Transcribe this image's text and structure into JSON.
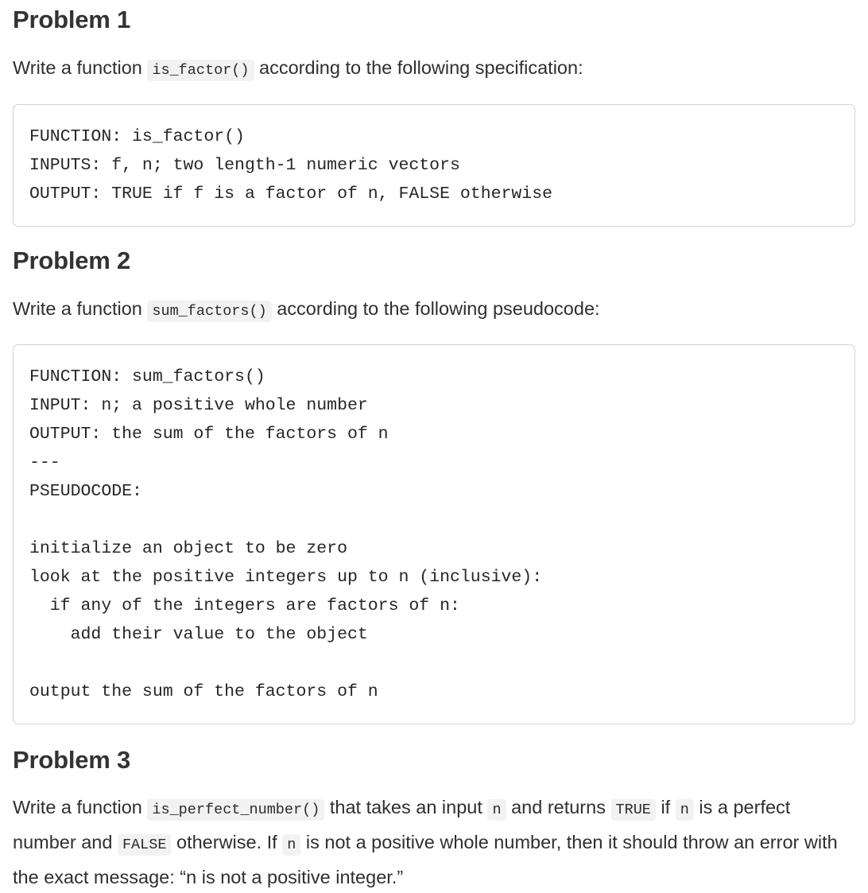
{
  "document": {
    "colors": {
      "text": "#2f2f2f",
      "heading": "#333333",
      "code_text": "#262626",
      "inline_code_bg": "#f2f2f2",
      "box_border": "#d2d2d2",
      "background": "#ffffff"
    },
    "problems": [
      {
        "heading": "Problem 1",
        "prompt": {
          "before": "Write a function",
          "code": "is_factor()",
          "after": "according to the following specification:"
        },
        "code_block": "FUNCTION: is_factor()\nINPUTS: f, n; two length-1 numeric vectors\nOUTPUT: TRUE if f is a factor of n, FALSE otherwise"
      },
      {
        "heading": "Problem 2",
        "prompt": {
          "before": "Write a function",
          "code": "sum_factors()",
          "after": "according to the following pseudocode:"
        },
        "code_block": "FUNCTION: sum_factors()\nINPUT: n; a positive whole number\nOUTPUT: the sum of the factors of n\n---\nPSEUDOCODE:\n\ninitialize an object to be zero\nlook at the positive integers up to n (inclusive):\n  if any of the integers are factors of n:\n    add their value to the object\n\noutput the sum of the factors of n"
      },
      {
        "heading": "Problem 3",
        "body": {
          "s1": "Write a function",
          "c1": "is_perfect_number()",
          "s2": "that takes an input",
          "c2": "n",
          "s3": "and returns",
          "c3": "TRUE",
          "s4": "if",
          "c4": "n",
          "s5": "is a perfect number and",
          "c5": "FALSE",
          "s6": "otherwise. If",
          "c6": "n",
          "s7": "is not a positive whole number, then it should throw an error with the exact message: “n is not a positive integer.”"
        }
      }
    ]
  }
}
